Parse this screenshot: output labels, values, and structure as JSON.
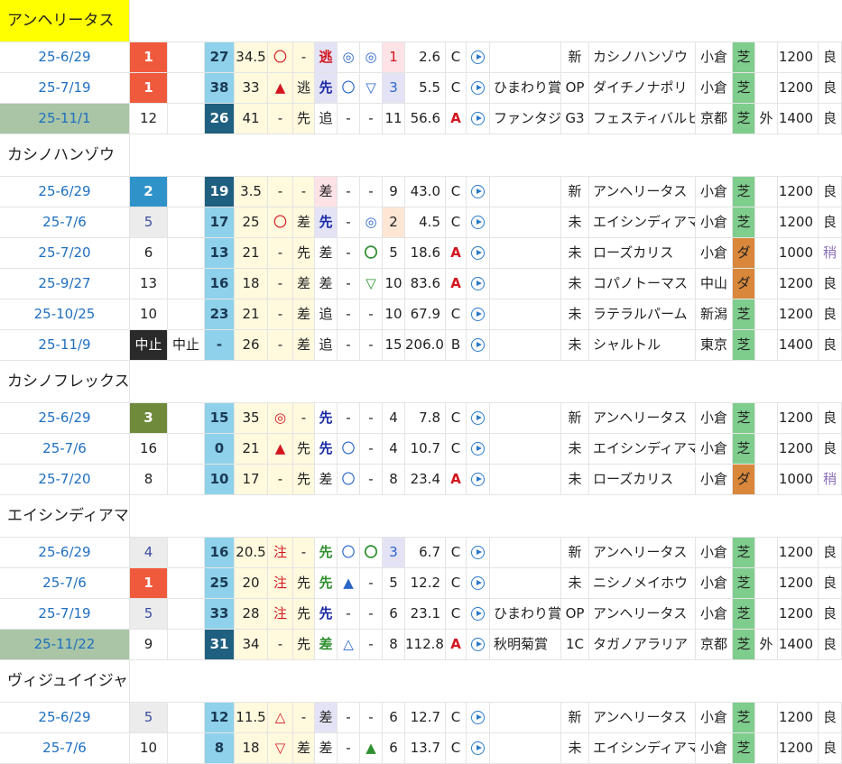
{
  "groups": [
    {
      "horse": "アンヘリータス",
      "highlight": true,
      "rows": [
        {
          "date": "25-6/29",
          "date_past": false,
          "pos": "1",
          "pos_style": "pos1",
          "sub": "",
          "num": "27",
          "num_style": "num-l",
          "v1": "34.5",
          "m1": "〇",
          "m1c": "red",
          "m2": "-",
          "m2c": "",
          "m3": "逃",
          "m3c": "redb",
          "m3bg": "lav",
          "m4": "◎",
          "m4c": "blue",
          "m5": "◎",
          "m5c": "blue",
          "pop": "1",
          "popbg": "pink",
          "popc": "red",
          "odds": "2.6",
          "grade": "C",
          "gc": "",
          "race": "",
          "cls": "新",
          "opp": "カシノハンゾウ",
          "track": "小倉",
          "surf": "芝",
          "surfbg": "turf",
          "io": "",
          "dist": "1200",
          "cond": "良",
          "condc": ""
        },
        {
          "date": "25-7/19",
          "date_past": false,
          "pos": "1",
          "pos_style": "pos1",
          "sub": "",
          "num": "38",
          "num_style": "num-l",
          "v1": "33",
          "m1": "▲",
          "m1c": "redtri",
          "m2": "逃",
          "m2c": "",
          "m3": "先",
          "m3c": "navyb",
          "m3bg": "lav",
          "m4": "〇",
          "m4c": "blue",
          "m5": "▽",
          "m5c": "blue",
          "pop": "3",
          "popbg": "lav",
          "popc": "blue",
          "odds": "5.5",
          "grade": "C",
          "gc": "",
          "race": "ひまわり賞",
          "cls": "OP",
          "opp": "ダイチノナポリ",
          "track": "小倉",
          "surf": "芝",
          "surfbg": "turf",
          "io": "",
          "dist": "1200",
          "cond": "良",
          "condc": ""
        },
        {
          "date": "25-11/1",
          "date_past": true,
          "pos": "12",
          "pos_style": "",
          "sub": "",
          "num": "26",
          "num_style": "num-d",
          "v1": "41",
          "m1": "-",
          "m1c": "",
          "m2": "先",
          "m2c": "",
          "m3": "追",
          "m3c": "",
          "m3bg": "",
          "m4": "-",
          "m4c": "",
          "m5": "-",
          "m5c": "",
          "pop": "11",
          "popbg": "",
          "popc": "",
          "odds": "56.6",
          "grade": "A",
          "gc": "redb",
          "race": "ファンタジー",
          "cls": "G3",
          "opp": "フェスティバルヒル",
          "track": "京都",
          "surf": "芝",
          "surfbg": "turf",
          "io": "外",
          "dist": "1400",
          "cond": "良",
          "condc": ""
        }
      ]
    },
    {
      "horse": "カシノハンゾウ",
      "highlight": false,
      "rows": [
        {
          "date": "25-6/29",
          "date_past": false,
          "pos": "2",
          "pos_style": "pos2",
          "sub": "",
          "num": "19",
          "num_style": "num-d",
          "v1": "3.5",
          "m1": "-",
          "m1c": "",
          "m2": "-",
          "m2c": "",
          "m3": "差",
          "m3c": "",
          "m3bg": "pink",
          "m4": "-",
          "m4c": "",
          "m5": "-",
          "m5c": "",
          "pop": "9",
          "popbg": "",
          "popc": "",
          "odds": "43.0",
          "grade": "C",
          "gc": "",
          "race": "",
          "cls": "新",
          "opp": "アンヘリータス",
          "track": "小倉",
          "surf": "芝",
          "surfbg": "turf",
          "io": "",
          "dist": "1200",
          "cond": "良",
          "condc": ""
        },
        {
          "date": "25-7/6",
          "date_past": false,
          "pos": "5",
          "pos_style": "posg",
          "sub": "",
          "num": "17",
          "num_style": "num-l",
          "v1": "25",
          "m1": "〇",
          "m1c": "red",
          "m2": "差",
          "m2c": "",
          "m3": "先",
          "m3c": "navyb",
          "m3bg": "lav",
          "m4": "-",
          "m4c": "",
          "m5": "◎",
          "m5c": "blue",
          "pop": "2",
          "popbg": "peach",
          "popc": "",
          "odds": "4.5",
          "grade": "C",
          "gc": "",
          "race": "",
          "cls": "未",
          "opp": "エイシンディアマン",
          "track": "小倉",
          "surf": "芝",
          "surfbg": "turf",
          "io": "",
          "dist": "1200",
          "cond": "良",
          "condc": ""
        },
        {
          "date": "25-7/20",
          "date_past": false,
          "pos": "6",
          "pos_style": "",
          "sub": "",
          "num": "13",
          "num_style": "num-l",
          "v1": "21",
          "m1": "-",
          "m1c": "",
          "m2": "先",
          "m2c": "",
          "m3": "差",
          "m3c": "",
          "m3bg": "",
          "m4": "-",
          "m4c": "",
          "m5": "〇",
          "m5c": "greenb",
          "pop": "5",
          "popbg": "",
          "popc": "",
          "odds": "18.6",
          "grade": "A",
          "gc": "redb",
          "race": "",
          "cls": "未",
          "opp": "ローズカリス",
          "track": "小倉",
          "surf": "ダ",
          "surfbg": "dirt",
          "io": "",
          "dist": "1000",
          "cond": "稍",
          "condc": "purple"
        },
        {
          "date": "25-9/27",
          "date_past": false,
          "pos": "13",
          "pos_style": "",
          "sub": "",
          "num": "16",
          "num_style": "num-l",
          "v1": "18",
          "m1": "-",
          "m1c": "",
          "m2": "差",
          "m2c": "",
          "m3": "差",
          "m3c": "",
          "m3bg": "",
          "m4": "-",
          "m4c": "",
          "m5": "▽",
          "m5c": "greenb",
          "pop": "10",
          "popbg": "",
          "popc": "",
          "odds": "83.6",
          "grade": "A",
          "gc": "redb",
          "race": "",
          "cls": "未",
          "opp": "コパノトーマス",
          "track": "中山",
          "surf": "ダ",
          "surfbg": "dirt",
          "io": "",
          "dist": "1200",
          "cond": "良",
          "condc": ""
        },
        {
          "date": "25-10/25",
          "date_past": false,
          "pos": "10",
          "pos_style": "",
          "sub": "",
          "num": "23",
          "num_style": "num-l",
          "v1": "21",
          "m1": "-",
          "m1c": "",
          "m2": "差",
          "m2c": "",
          "m3": "追",
          "m3c": "",
          "m3bg": "",
          "m4": "-",
          "m4c": "",
          "m5": "-",
          "m5c": "",
          "pop": "10",
          "popbg": "",
          "popc": "",
          "odds": "67.9",
          "grade": "C",
          "gc": "",
          "race": "",
          "cls": "未",
          "opp": "ラテラルパーム",
          "track": "新潟",
          "surf": "芝",
          "surfbg": "turf",
          "io": "",
          "dist": "1200",
          "cond": "良",
          "condc": ""
        },
        {
          "date": "25-11/9",
          "date_past": false,
          "pos": "中止",
          "pos_style": "posx",
          "sub": "中止",
          "num": "-",
          "num_style": "num-l",
          "v1": "26",
          "m1": "-",
          "m1c": "",
          "m2": "差",
          "m2c": "",
          "m3": "追",
          "m3c": "",
          "m3bg": "",
          "m4": "-",
          "m4c": "",
          "m5": "-",
          "m5c": "",
          "pop": "15",
          "popbg": "",
          "popc": "",
          "odds": "206.0",
          "grade": "B",
          "gc": "",
          "race": "",
          "cls": "未",
          "opp": "シャルトル",
          "track": "東京",
          "surf": "芝",
          "surfbg": "turf",
          "io": "",
          "dist": "1400",
          "cond": "良",
          "condc": ""
        }
      ]
    },
    {
      "horse": "カシノフレックス",
      "highlight": false,
      "rows": [
        {
          "date": "25-6/29",
          "date_past": false,
          "pos": "3",
          "pos_style": "pos3",
          "sub": "",
          "num": "15",
          "num_style": "num-l",
          "v1": "35",
          "m1": "◎",
          "m1c": "red",
          "m2": "-",
          "m2c": "",
          "m3": "先",
          "m3c": "navyb",
          "m3bg": "",
          "m4": "-",
          "m4c": "",
          "m5": "-",
          "m5c": "",
          "pop": "4",
          "popbg": "",
          "popc": "",
          "odds": "7.8",
          "grade": "C",
          "gc": "",
          "race": "",
          "cls": "新",
          "opp": "アンヘリータス",
          "track": "小倉",
          "surf": "芝",
          "surfbg": "turf",
          "io": "",
          "dist": "1200",
          "cond": "良",
          "condc": ""
        },
        {
          "date": "25-7/6",
          "date_past": false,
          "pos": "16",
          "pos_style": "",
          "sub": "",
          "num": "0",
          "num_style": "num-l",
          "v1": "21",
          "m1": "▲",
          "m1c": "redtri",
          "m2": "先",
          "m2c": "",
          "m3": "先",
          "m3c": "navyb",
          "m3bg": "",
          "m4": "〇",
          "m4c": "blue",
          "m5": "-",
          "m5c": "",
          "pop": "4",
          "popbg": "",
          "popc": "",
          "odds": "10.7",
          "grade": "C",
          "gc": "",
          "race": "",
          "cls": "未",
          "opp": "エイシンディアマン",
          "track": "小倉",
          "surf": "芝",
          "surfbg": "turf",
          "io": "",
          "dist": "1200",
          "cond": "良",
          "condc": ""
        },
        {
          "date": "25-7/20",
          "date_past": false,
          "pos": "8",
          "pos_style": "",
          "sub": "",
          "num": "10",
          "num_style": "num-l",
          "v1": "17",
          "m1": "-",
          "m1c": "",
          "m2": "先",
          "m2c": "",
          "m3": "差",
          "m3c": "",
          "m3bg": "",
          "m4": "〇",
          "m4c": "blue",
          "m5": "-",
          "m5c": "",
          "pop": "8",
          "popbg": "",
          "popc": "",
          "odds": "23.4",
          "grade": "A",
          "gc": "redb",
          "race": "",
          "cls": "未",
          "opp": "ローズカリス",
          "track": "小倉",
          "surf": "ダ",
          "surfbg": "dirt",
          "io": "",
          "dist": "1000",
          "cond": "稍",
          "condc": "purple"
        }
      ]
    },
    {
      "horse": "エイシンディアマン",
      "highlight": false,
      "rows": [
        {
          "date": "25-6/29",
          "date_past": false,
          "pos": "4",
          "pos_style": "posg",
          "sub": "",
          "num": "16",
          "num_style": "num-l",
          "v1": "20.5",
          "m1": "注",
          "m1c": "red",
          "m2": "-",
          "m2c": "",
          "m3": "先",
          "m3c": "greenb",
          "m3bg": "",
          "m4": "〇",
          "m4c": "blue",
          "m5": "〇",
          "m5c": "greenb",
          "pop": "3",
          "popbg": "lav",
          "popc": "blue",
          "odds": "6.7",
          "grade": "C",
          "gc": "",
          "race": "",
          "cls": "新",
          "opp": "アンヘリータス",
          "track": "小倉",
          "surf": "芝",
          "surfbg": "turf",
          "io": "",
          "dist": "1200",
          "cond": "良",
          "condc": ""
        },
        {
          "date": "25-7/6",
          "date_past": false,
          "pos": "1",
          "pos_style": "pos1",
          "sub": "",
          "num": "25",
          "num_style": "num-l",
          "v1": "20",
          "m1": "注",
          "m1c": "red",
          "m2": "先",
          "m2c": "",
          "m3": "先",
          "m3c": "greenb",
          "m3bg": "",
          "m4": "▲",
          "m4c": "bluetri",
          "m5": "-",
          "m5c": "",
          "pop": "5",
          "popbg": "",
          "popc": "",
          "odds": "12.2",
          "grade": "C",
          "gc": "",
          "race": "",
          "cls": "未",
          "opp": "ニシノメイホウ",
          "track": "小倉",
          "surf": "芝",
          "surfbg": "turf",
          "io": "",
          "dist": "1200",
          "cond": "良",
          "condc": ""
        },
        {
          "date": "25-7/19",
          "date_past": false,
          "pos": "5",
          "pos_style": "posg",
          "sub": "",
          "num": "33",
          "num_style": "num-l",
          "v1": "28",
          "m1": "注",
          "m1c": "red",
          "m2": "先",
          "m2c": "",
          "m3": "先",
          "m3c": "navyb",
          "m3bg": "",
          "m4": "-",
          "m4c": "",
          "m5": "-",
          "m5c": "",
          "pop": "6",
          "popbg": "",
          "popc": "",
          "odds": "23.1",
          "grade": "C",
          "gc": "",
          "race": "ひまわり賞",
          "cls": "OP",
          "opp": "アンヘリータス",
          "track": "小倉",
          "surf": "芝",
          "surfbg": "turf",
          "io": "",
          "dist": "1200",
          "cond": "良",
          "condc": ""
        },
        {
          "date": "25-11/22",
          "date_past": true,
          "pos": "9",
          "pos_style": "",
          "sub": "",
          "num": "31",
          "num_style": "num-d",
          "v1": "34",
          "m1": "-",
          "m1c": "",
          "m2": "先",
          "m2c": "",
          "m3": "差",
          "m3c": "greenb",
          "m3bg": "",
          "m4": "△",
          "m4c": "blue",
          "m5": "-",
          "m5c": "",
          "pop": "8",
          "popbg": "",
          "popc": "",
          "odds": "112.8",
          "grade": "A",
          "gc": "redb",
          "race": "秋明菊賞",
          "cls": "1C",
          "opp": "タガノアラリア",
          "track": "京都",
          "surf": "芝",
          "surfbg": "turf",
          "io": "外",
          "dist": "1400",
          "cond": "良",
          "condc": ""
        }
      ]
    },
    {
      "horse": "ヴィジュイイジャン",
      "highlight": false,
      "rows": [
        {
          "date": "25-6/29",
          "date_past": false,
          "pos": "5",
          "pos_style": "posg",
          "sub": "",
          "num": "12",
          "num_style": "num-l",
          "v1": "11.5",
          "m1": "△",
          "m1c": "red",
          "m2": "-",
          "m2c": "",
          "m3": "差",
          "m3c": "",
          "m3bg": "lav",
          "m4": "-",
          "m4c": "",
          "m5": "-",
          "m5c": "",
          "pop": "6",
          "popbg": "",
          "popc": "",
          "odds": "12.7",
          "grade": "C",
          "gc": "",
          "race": "",
          "cls": "新",
          "opp": "アンヘリータス",
          "track": "小倉",
          "surf": "芝",
          "surfbg": "turf",
          "io": "",
          "dist": "1200",
          "cond": "良",
          "condc": ""
        },
        {
          "date": "25-7/6",
          "date_past": false,
          "pos": "10",
          "pos_style": "",
          "sub": "",
          "num": "8",
          "num_style": "num-l",
          "v1": "18",
          "m1": "▽",
          "m1c": "red",
          "m2": "差",
          "m2c": "",
          "m3": "差",
          "m3c": "",
          "m3bg": "",
          "m4": "-",
          "m4c": "",
          "m5": "▲",
          "m5c": "greentri",
          "pop": "6",
          "popbg": "",
          "popc": "",
          "odds": "13.7",
          "grade": "C",
          "gc": "",
          "race": "",
          "cls": "未",
          "opp": "エイシンディアマン",
          "track": "小倉",
          "surf": "芝",
          "surfbg": "turf",
          "io": "",
          "dist": "1200",
          "cond": "良",
          "condc": ""
        }
      ]
    }
  ]
}
